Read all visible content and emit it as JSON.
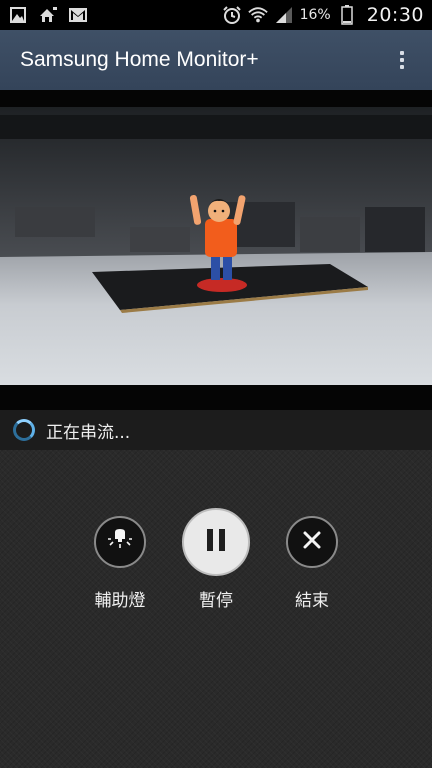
{
  "status_bar": {
    "left_icons": [
      "gallery-icon",
      "home-notification-icon",
      "gmail-icon"
    ],
    "right_icons": [
      "alarm-icon",
      "wifi-icon",
      "signal-icon",
      "battery-icon"
    ],
    "battery_percent": "16%",
    "time": "20:30"
  },
  "app_bar": {
    "title": "Samsung Home Monitor+",
    "menu_icon": "overflow-menu-icon"
  },
  "stream": {
    "status_text": "正在串流..."
  },
  "controls": {
    "aux_light_label": "輔助燈",
    "pause_label": "暫停",
    "end_label": "結束"
  },
  "colors": {
    "app_bar": "#3a4a5e",
    "spinner": "#5fb1e8"
  }
}
